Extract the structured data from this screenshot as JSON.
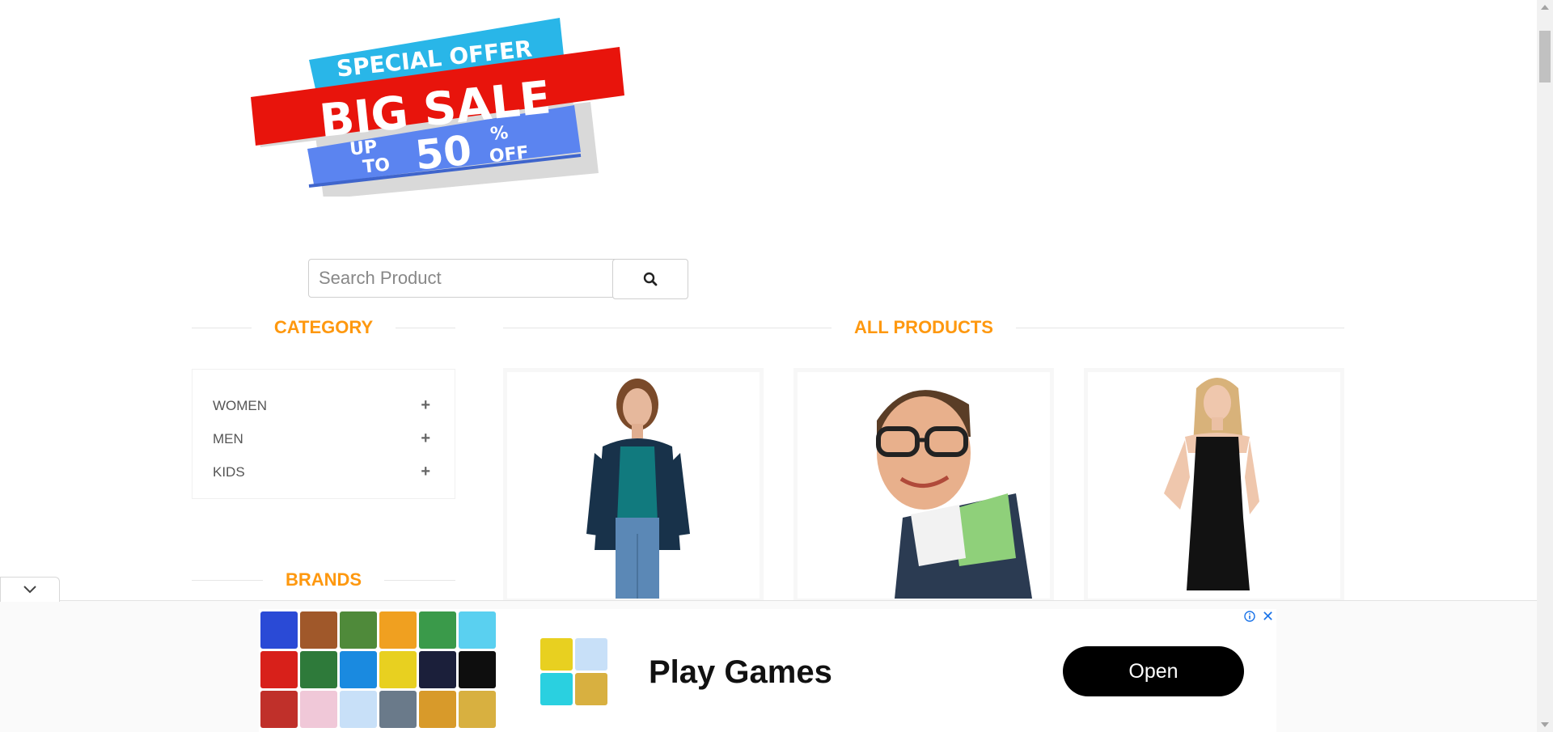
{
  "banner": {
    "line1": "SPECIAL OFFER",
    "line2": "BIG SALE",
    "up": "UP",
    "to": "TO",
    "number": "50",
    "percent": "%",
    "off": "OFF",
    "colors": {
      "cyan": "#29b6e8",
      "red": "#e8140c",
      "blue": "#5b84f0"
    }
  },
  "search": {
    "placeholder": "Search Product",
    "icon": "search-icon"
  },
  "sidebar": {
    "category_title": "CATEGORY",
    "categories": [
      {
        "label": "WOMEN",
        "icon": "plus-icon"
      },
      {
        "label": "MEN",
        "icon": "plus-icon"
      },
      {
        "label": "KIDS",
        "icon": "plus-icon"
      }
    ],
    "brands_title": "BRANDS"
  },
  "main": {
    "title": "ALL PRODUCTS"
  },
  "ad": {
    "headline": "Play Games",
    "button": "Open",
    "info_icon": "info-icon",
    "close_icon": "close-icon"
  },
  "accent_color": "#fe980f"
}
